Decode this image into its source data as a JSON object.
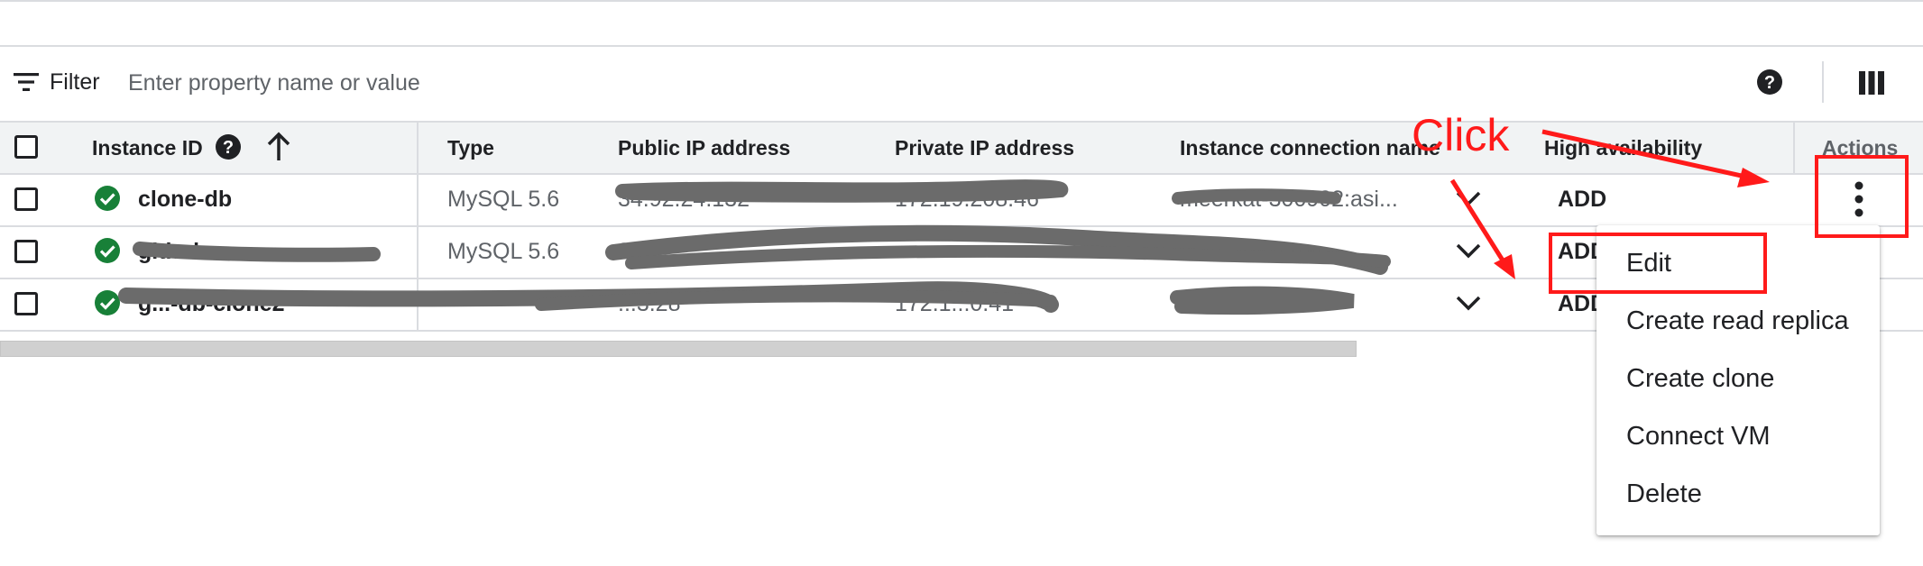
{
  "filter": {
    "label": "Filter",
    "placeholder": "Enter property name or value",
    "value": ""
  },
  "toolbar_icons": [
    "filter-icon",
    "help-icon",
    "column-display-icon"
  ],
  "table": {
    "columns": [
      "Instance ID",
      "Type",
      "Public IP address",
      "Private IP address",
      "Instance connection name",
      "High availability",
      "Actions"
    ],
    "sort_direction": "ascending",
    "rows": [
      {
        "instance_id": "clone-db",
        "type": "MySQL 5.6",
        "public_ip": "34.92.24.132",
        "private_ip": "172.19.208.46",
        "connection_name": "meerkat-300902:asi...",
        "high_availability": "ADD"
      },
      {
        "instance_id": "github",
        "type": "MySQL 5.6",
        "public_ip": "34.",
        "private_ip": "",
        "connection_name": "...sia-...ci...",
        "high_availability": "ADD"
      },
      {
        "instance_id": "g...-db-clone2",
        "type": "",
        "public_ip": "...3.28",
        "private_ip": "172.1...0.41",
        "connection_name": "...ci...",
        "high_availability": "ADD"
      }
    ]
  },
  "actions_menu": {
    "items": [
      "Edit",
      "Create read replica",
      "Create clone",
      "Connect VM",
      "Delete"
    ]
  },
  "annotation": {
    "label": "Click",
    "color": "#ff1a1a"
  },
  "colors": {
    "status_ok": "#188038",
    "header_bg": "#f1f3f4",
    "divider": "#dadce0"
  }
}
